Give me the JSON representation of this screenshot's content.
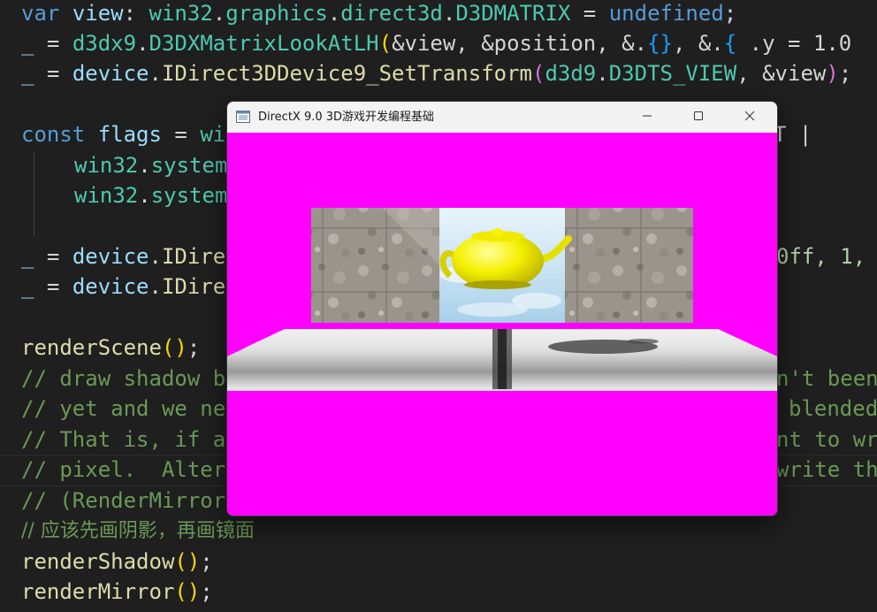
{
  "code": {
    "l1": {
      "t1": "var",
      "t2": "view",
      "t3": ": ",
      "t4": "win32",
      "t5": ".",
      "t6": "graphics",
      "t7": ".",
      "t8": "direct3d",
      "t9": ".",
      "t10": "D3DMATRIX",
      "t11": " = ",
      "t12": "undefined",
      "t13": ";"
    },
    "l2": {
      "t1": "_",
      "t2": " = ",
      "t3": "d3dx9",
      "t4": ".",
      "t5": "D3DXMatrixLookAtLH",
      "t6": "(",
      "t7": "&view, &position, &.",
      "t8": "{}",
      "t9": ", &.",
      "t10": "{",
      "t11": " .y = 1.0"
    },
    "l3": {
      "t1": "_",
      "t2": " = ",
      "t3": "device",
      "t4": ".",
      "t5": "IDirect3DDevice9_SetTransform",
      "t6": "(",
      "t7": "d3d9",
      "t8": ".",
      "t9": "D3DTS_VIEW",
      "t10": ", &view",
      "t11": ")",
      "t12": ";"
    },
    "l5": {
      "t1": "const",
      "t2": " flags",
      "t3": " = ",
      "t4": "wi",
      "t5": "T |"
    },
    "l6": {
      "t1": "win32",
      "t2": ".",
      "t3": "system"
    },
    "l7": {
      "t1": "win32",
      "t2": ".",
      "t3": "system"
    },
    "l9": {
      "t1": "_",
      "t2": " = ",
      "t3": "device",
      "t4": ".",
      "t5": "IDire",
      "t6": "0ff, 1,"
    },
    "l10": {
      "t1": "_",
      "t2": " = ",
      "t3": "device",
      "t4": ".",
      "t5": "IDire"
    },
    "l12": {
      "t1": "renderScene",
      "t2": "()",
      "t3": ";"
    },
    "c13": {
      "a": "// draw shadow b",
      "b": "n't been"
    },
    "c14": {
      "a": "// yet and we ne",
      "b": "blended"
    },
    "c15": {
      "a": "// That is, if a",
      "b": "nt to wr"
    },
    "c16": {
      "a": "// pixel.  Alter",
      "b": "write th"
    },
    "c17": {
      "a": "// (RenderMirror"
    },
    "c18": {
      "a": "// 应该先画阴影，再画镜面"
    },
    "l19": {
      "t1": "renderShadow",
      "t2": "()",
      "t3": ";"
    },
    "l20": {
      "t1": "renderMirror",
      "t2": "()",
      "t3": ";"
    }
  },
  "window": {
    "title": "DirectX 9.0 3D游戏开发编程基础",
    "icons": {
      "app": "app-window-icon",
      "min": "minimize-icon",
      "max": "maximize-icon",
      "close": "close-icon"
    },
    "scene": {
      "background": "#ff00ff",
      "objects": [
        "crate-wall-left",
        "mirror",
        "teapot",
        "crate-wall-right",
        "floor",
        "teapot-shadow"
      ]
    }
  }
}
